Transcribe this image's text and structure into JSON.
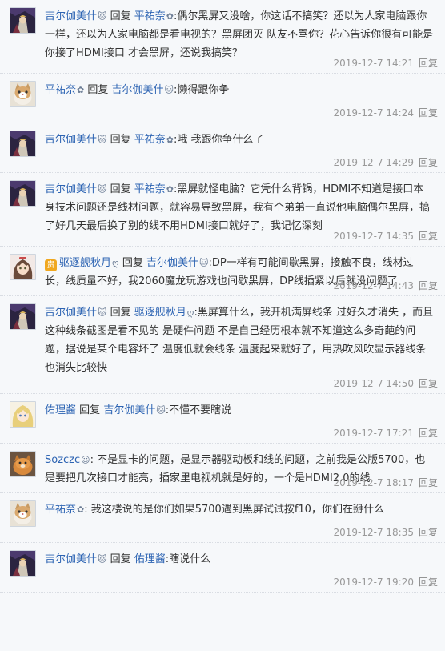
{
  "replies": [
    {
      "author": "吉尔伽美什",
      "author_badge": "🐱",
      "reply_word": "回复",
      "target": "平祐奈",
      "target_badge": "✿",
      "text": ":偶尔黑屏又没啥，你这话不搞笑？还以为人家电脑跟你一样，还以为人家电脑都是看电视的？黑屏团灭 队友不骂你？花心告诉你很有可能是你接了HDMI接口 才会黑屏，还说我搞笑？",
      "time": "2019-12-7 14:21",
      "reply_label": "回复",
      "avatar": "knight"
    },
    {
      "author": "平祐奈",
      "author_badge": "✿",
      "reply_word": "回复",
      "target": "吉尔伽美什",
      "target_badge": "🐱",
      "text": ":懒得跟你争",
      "time": "2019-12-7 14:24",
      "reply_label": "回复",
      "avatar": "cat"
    },
    {
      "author": "吉尔伽美什",
      "author_badge": "🐱",
      "reply_word": "回复",
      "target": "平祐奈",
      "target_badge": "✿",
      "text": ":哦 我跟你争什么了",
      "time": "2019-12-7 14:29",
      "reply_label": "回复",
      "avatar": "knight"
    },
    {
      "author": "吉尔伽美什",
      "author_badge": "🐱",
      "reply_word": "回复",
      "target": "平祐奈",
      "target_badge": "✿",
      "text": ":黑屏就怪电脑？它凭什么背锅，HDMI不知道是接口本身技术问题还是线材问题，就容易导致黑屏，我有个弟弟一直说他电脑偶尔黑屏，搞了好几天最后换了别的线不用HDMI接口就好了，我记忆深刻",
      "time": "2019-12-7 14:35",
      "reply_label": "回复",
      "avatar": "knight"
    },
    {
      "author": "驱逐舰秋月",
      "author_badge": "ღ",
      "vip": "贵",
      "reply_word": "回复",
      "target": "吉尔伽美什",
      "target_badge": "🐱",
      "text": ":DP一样有可能间歇黑屏，接触不良，线材过长，线质量不好，我2060魔龙玩游戏也间歇黑屏，DP线插紧以后就没问题了",
      "time": "2019-12-7 14:43",
      "reply_label": "回复",
      "avatar": "anime"
    },
    {
      "author": "吉尔伽美什",
      "author_badge": "🐱",
      "reply_word": "回复",
      "target": "驱逐舰秋月",
      "target_badge": "ღ",
      "text": ":黑屏算什么，我开机满屏线条 过好久才消失 ，而且这种线条截图是看不见的 是硬件问题 不是自己经历根本就不知道这么多奇葩的问题，据说是某个电容坏了 温度低就会线条 温度起来就好了，用热吹风吹显示器线条也消失比较快",
      "time": "2019-12-7 14:50",
      "reply_label": "回复",
      "avatar": "knight"
    },
    {
      "author": "佑理酱",
      "author_badge": "",
      "reply_word": "回复",
      "target": "吉尔伽美什",
      "target_badge": "🐱",
      "text": ":不懂不要瞎说",
      "time": "2019-12-7 17:21",
      "reply_label": "回复",
      "avatar": "blonde"
    },
    {
      "author": "Sozczc",
      "author_badge": "☺",
      "reply_word": "",
      "target": "",
      "target_badge": "",
      "text": ": 不是显卡的问题，是显示器驱动板和线的问题，之前我是公版5700，也是要把几次接口才能亮，插家里电视机就是好的，一个是HDMI2.0的线",
      "time": "2019-12-7 18:17",
      "reply_label": "回复",
      "avatar": "orange"
    },
    {
      "author": "平祐奈",
      "author_badge": "✿",
      "reply_word": "",
      "target": "",
      "target_badge": "",
      "text": ": 我这楼说的是你们如果5700遇到黑屏试试按f10，你们在掰什么",
      "time": "2019-12-7 18:35",
      "reply_label": "回复",
      "avatar": "cat"
    },
    {
      "author": "吉尔伽美什",
      "author_badge": "🐱",
      "reply_word": "回复",
      "target": "佑理酱",
      "target_badge": "",
      "text": ":瞎说什么",
      "time": "2019-12-7 19:20",
      "reply_label": "回复",
      "avatar": "knight"
    }
  ]
}
